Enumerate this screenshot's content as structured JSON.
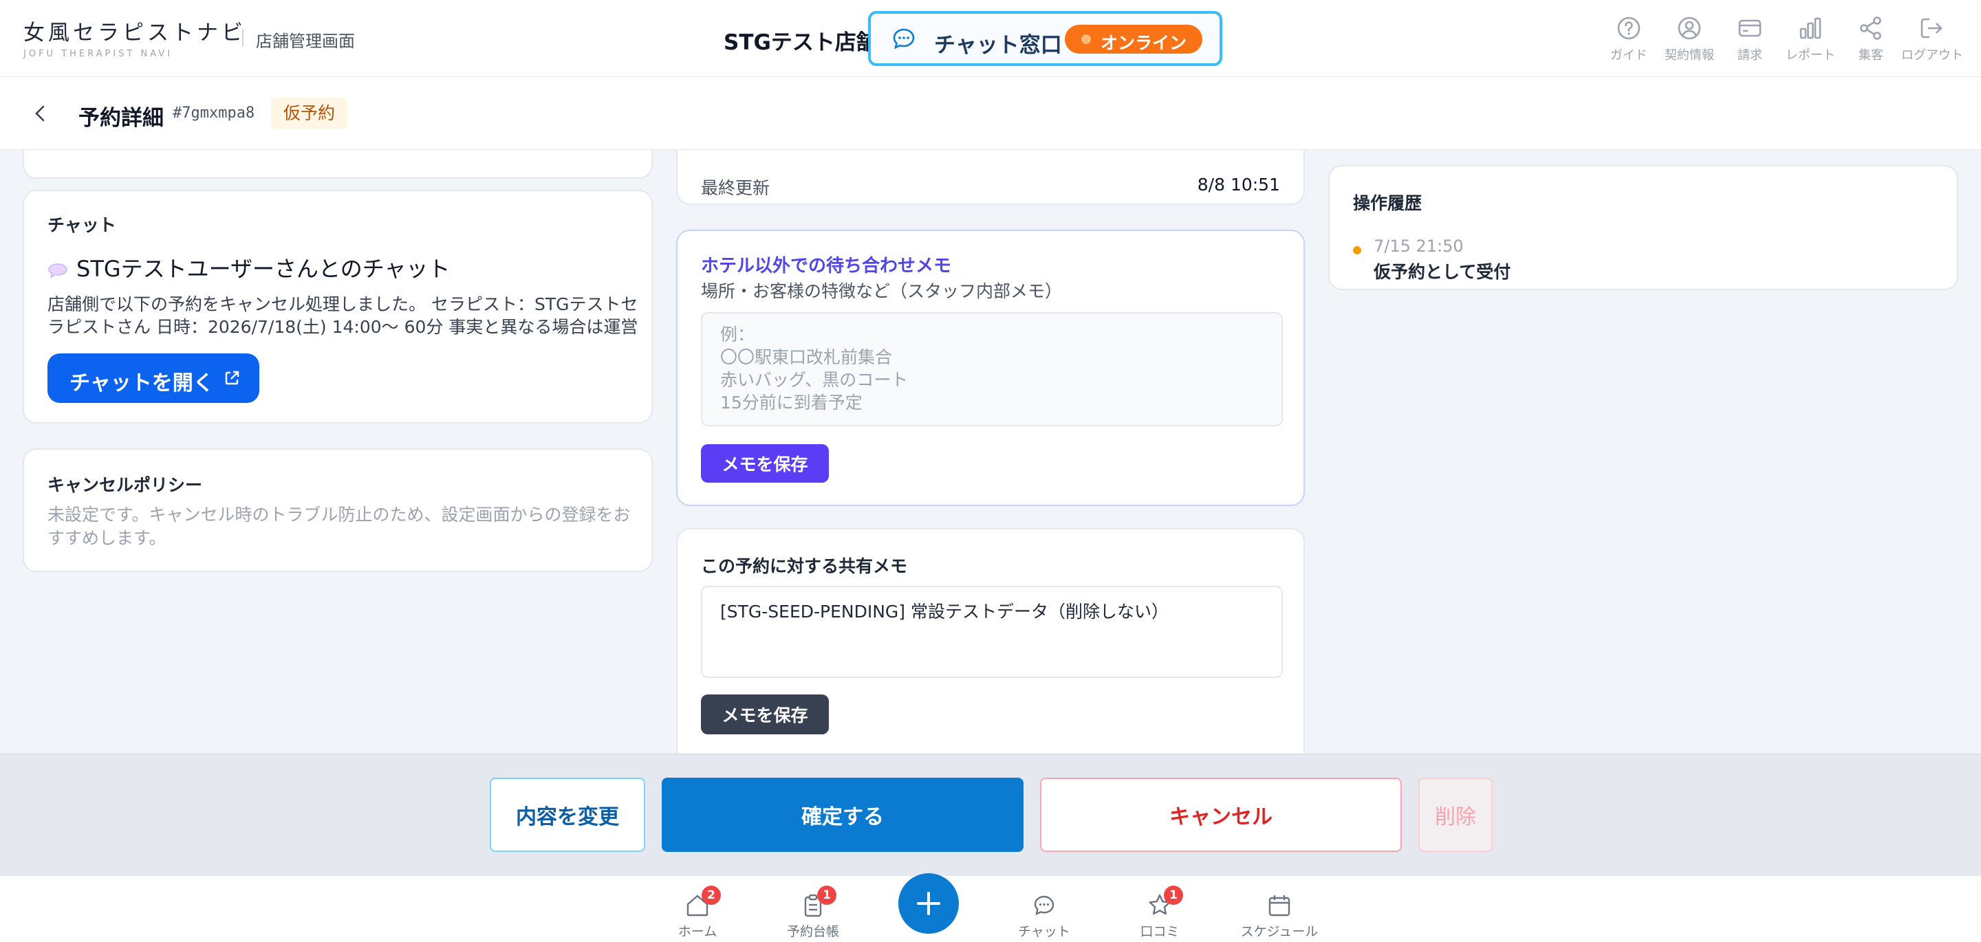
{
  "header": {
    "logo_main": "女風セラピストナビ",
    "logo_sub": "JOFU THERAPIST NAVI",
    "admin_label": "店舗管理画面",
    "store_name": "STGテスト店舗",
    "chat_window_label": "チャット窓口",
    "online_label": "オンライン",
    "nav": [
      {
        "label": "ガイド",
        "icon": "help-icon"
      },
      {
        "label": "契約情報",
        "icon": "user-icon"
      },
      {
        "label": "請求",
        "icon": "card-icon"
      },
      {
        "label": "レポート",
        "icon": "bar-chart-icon"
      },
      {
        "label": "集客",
        "icon": "share-icon"
      },
      {
        "label": "ログアウト",
        "icon": "logout-icon"
      }
    ]
  },
  "subheader": {
    "title": "予約詳細",
    "booking_id": "#7gmxmpa8",
    "status": "仮予約"
  },
  "chat_card": {
    "title": "チャット",
    "heading": "STGテストユーザーさんとのチャット",
    "preview": "店舗側で以下の予約をキャンセル処理しました。 セラピスト：STGテストセラピストさん 日時：2026/7/18(土) 14:00〜 60分 事実と異なる場合は運営に…",
    "open_button": "チャットを開く"
  },
  "policy_card": {
    "title": "キャンセルポリシー",
    "text": "未設定です。キャンセル時のトラブル防止のため、設定画面からの登録をおすすめします。"
  },
  "last_update": {
    "label": "最終更新",
    "value": "8/8 10:51"
  },
  "meeting_memo": {
    "title": "ホテル以外での待ち合わせメモ",
    "subtitle": "場所・お客様の特徴など（スタッフ内部メモ）",
    "placeholder": "例：\n〇〇駅東口改札前集合\n赤いバッグ、黒のコート\n15分前に到着予定",
    "save_button": "メモを保存"
  },
  "shared_memo": {
    "title": "この予約に対する共有メモ",
    "value": "[STG-SEED-PENDING] 常設テストデータ（削除しない）",
    "save_button": "メモを保存"
  },
  "history": {
    "title": "操作履歴",
    "items": [
      {
        "time": "7/15 21:50",
        "text": "仮予約として受付"
      }
    ]
  },
  "actions": {
    "edit": "内容を変更",
    "confirm": "確定する",
    "cancel": "キャンセル",
    "delete": "削除"
  },
  "bottom_nav": [
    {
      "label": "ホーム",
      "badge": "2",
      "icon": "home-icon"
    },
    {
      "label": "予約台帳",
      "badge": "1",
      "icon": "clipboard-icon"
    },
    {
      "label": "チャット",
      "badge": "",
      "icon": "chat-icon"
    },
    {
      "label": "口コミ",
      "badge": "1",
      "icon": "star-icon"
    },
    {
      "label": "スケジュール",
      "badge": "",
      "icon": "calendar-icon"
    }
  ],
  "colors": {
    "primary": "#0a7bd0",
    "online": "#f97316",
    "memo_accent": "#5b3df5",
    "danger": "#dc2626"
  }
}
